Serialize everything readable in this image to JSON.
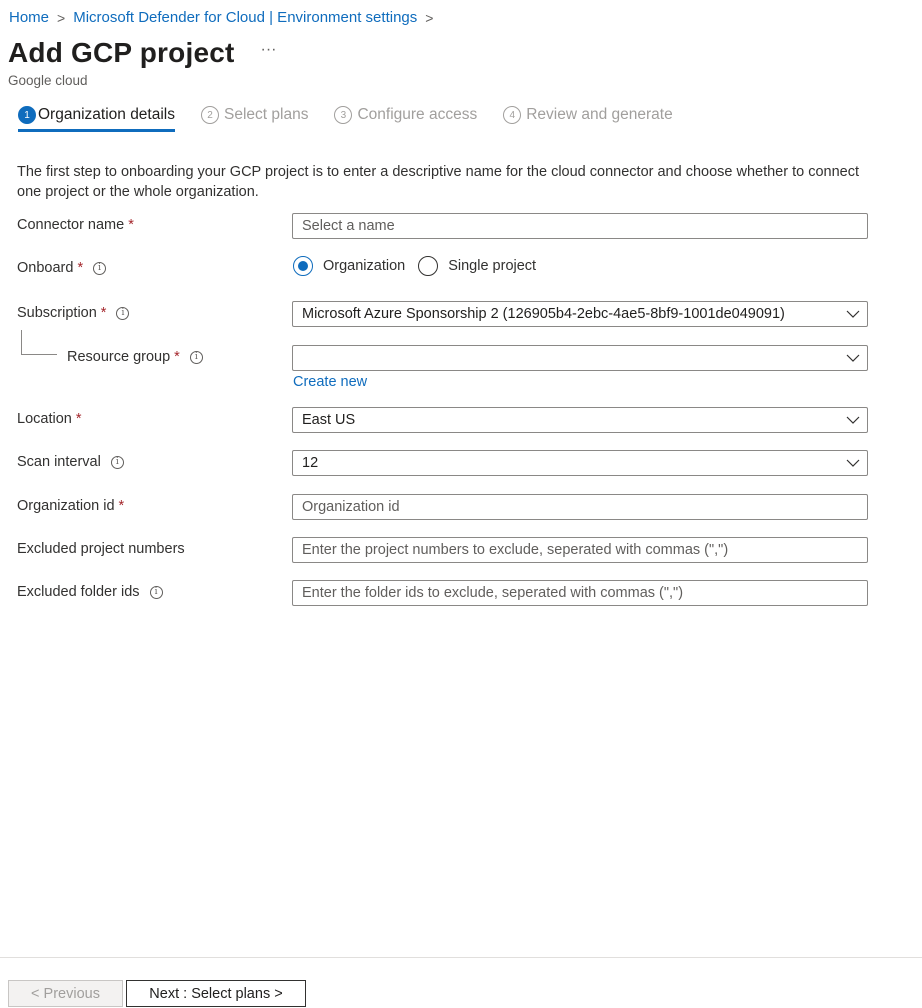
{
  "breadcrumb": {
    "home": "Home",
    "parent": "Microsoft Defender for Cloud | Environment settings"
  },
  "header": {
    "title": "Add GCP project",
    "more": "···",
    "subtitle": "Google cloud"
  },
  "wizard": {
    "steps": [
      {
        "num": "1",
        "label": "Organization details",
        "active": true
      },
      {
        "num": "2",
        "label": "Select plans",
        "active": false
      },
      {
        "num": "3",
        "label": "Configure access",
        "active": false
      },
      {
        "num": "4",
        "label": "Review and generate",
        "active": false
      }
    ]
  },
  "intro": "The first step to onboarding your GCP project is to enter a descriptive name for the cloud connector and choose whether to connect one project or the whole organization.",
  "form": {
    "connector_name": {
      "label": "Connector name",
      "required": "*",
      "placeholder": "Select a name",
      "value": ""
    },
    "onboard": {
      "label": "Onboard",
      "required": "*",
      "options": [
        "Organization",
        "Single project"
      ],
      "selected": "Organization"
    },
    "subscription": {
      "label": "Subscription",
      "required": "*",
      "value": "Microsoft Azure Sponsorship 2 (126905b4-2ebc-4ae5-8bf9-1001de049091)"
    },
    "resource_group": {
      "label": "Resource group",
      "required": "*",
      "value": "",
      "create_new": "Create new"
    },
    "location": {
      "label": "Location",
      "required": "*",
      "value": "East US"
    },
    "scan_interval": {
      "label": "Scan interval",
      "value": "12"
    },
    "organization_id": {
      "label": "Organization id",
      "required": "*",
      "placeholder": "Organization id",
      "value": ""
    },
    "excluded_projects": {
      "label": "Excluded project numbers",
      "placeholder": "Enter the project numbers to exclude, seperated with commas (\",\")",
      "value": ""
    },
    "excluded_folders": {
      "label": "Excluded folder ids",
      "placeholder": "Enter the folder ids to exclude, seperated with commas (\",\")",
      "value": ""
    }
  },
  "footer": {
    "previous": "< Previous",
    "next": "Next : Select plans >"
  },
  "icons": {
    "info": "info-icon",
    "chevron": "chevron-down-icon",
    "breadcrumb_sep": "chevron-right-icon"
  },
  "colors": {
    "accent": "#0f6cbd",
    "required": "#a4262c"
  }
}
